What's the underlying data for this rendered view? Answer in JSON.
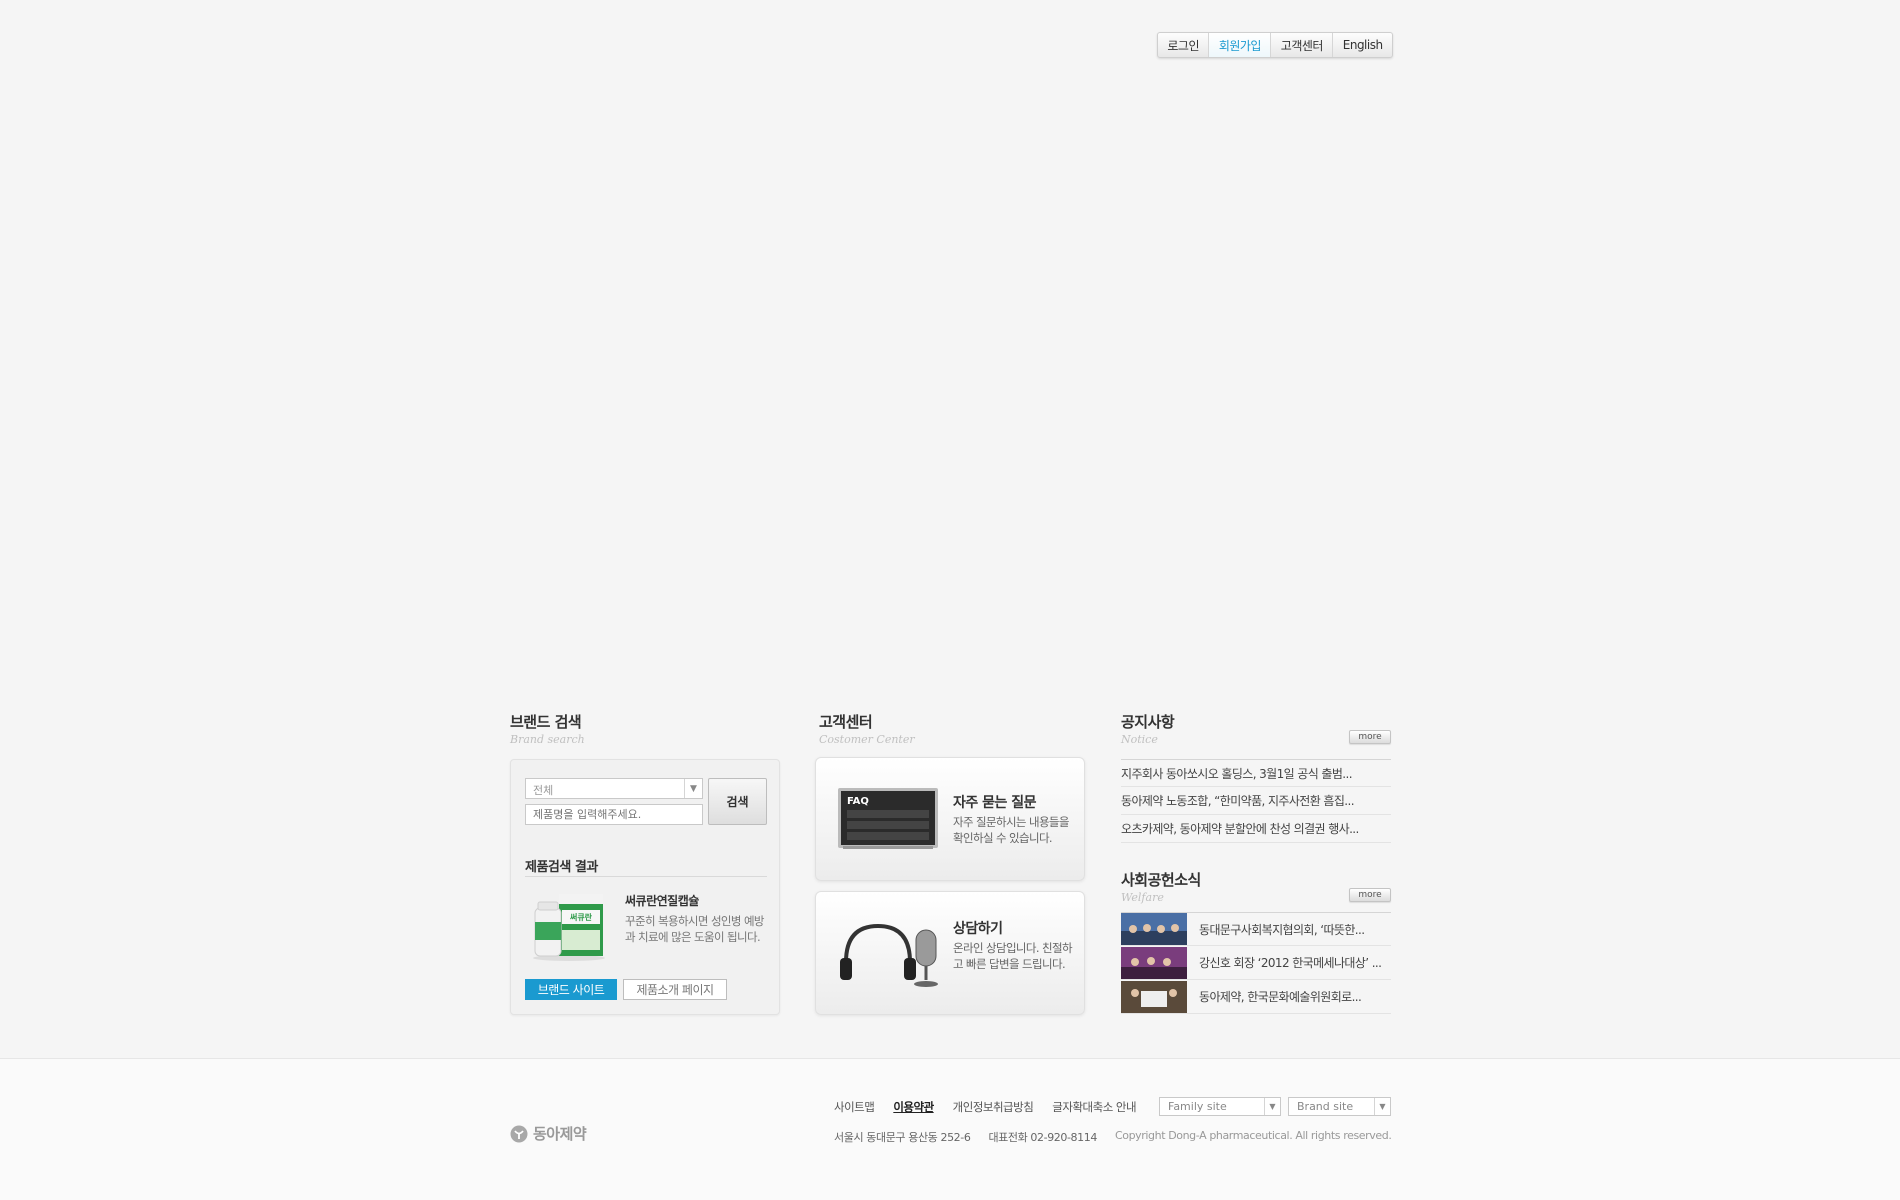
{
  "topnav": {
    "items": [
      "로그인",
      "회원가입",
      "고객센터",
      "English"
    ],
    "active_index": 1
  },
  "brand_search": {
    "title": "브랜드 검색",
    "subtitle": "Brand search",
    "category_value": "전체",
    "input_placeholder": "제품명을 입력해주세요.",
    "search_label": "검색",
    "result_title": "제품검색 결과",
    "product_name": "써큐란연질캡슐",
    "product_desc": "꾸준히 복용하시면 성인병 예방과 치료에 많은 도움이 됩니다.",
    "product_box_text": "써큐란",
    "brand_site_label": "브랜드 사이트",
    "intro_page_label": "제품소개 페이지"
  },
  "customer_center": {
    "title": "고객센터",
    "subtitle": "Costomer Center",
    "faq": {
      "screen_label": "FAQ",
      "title": "자주 묻는 질문",
      "desc": "자주 질문하시는 내용들을 확인하실 수 있습니다."
    },
    "consult": {
      "title": "상담하기",
      "desc": "온라인 상담입니다. 친절하고 빠른 답변을 드립니다."
    }
  },
  "notice": {
    "title": "공지사항",
    "subtitle": "Notice",
    "more_label": "more",
    "items": [
      "지주회사 동아쏘시오 홀딩스, 3월1일 공식 출범...",
      "동아제약 노동조합, “한미약품, 지주사전환 흠집...",
      "오츠카제약, 동아제약 분할안에 찬성 의결권 행사..."
    ]
  },
  "welfare": {
    "title": "사회공헌소식",
    "subtitle": "Welfare",
    "more_label": "more",
    "items": [
      "동대문구사회복지협의회, ‘따뜻한...",
      "강신호 회장 ‘2012 한국메세나대상’ ...",
      "동아제약, 한국문화예술위원회로..."
    ]
  },
  "footer": {
    "logo_text": "동아제약",
    "links": [
      "사이트맵",
      "이용약관",
      "개인정보취급방침",
      "글자확대축소 안내"
    ],
    "family_site": "Family site",
    "brand_site": "Brand site",
    "address": "서울시 동대문구 용산동 252-6",
    "phone": "대표전화 02-920-8114",
    "copyright": "Copyright Dong-A pharmaceutical. All rights reserved."
  },
  "colors": {
    "accent": "#1a9ad0",
    "background": "#f5f5f5"
  }
}
